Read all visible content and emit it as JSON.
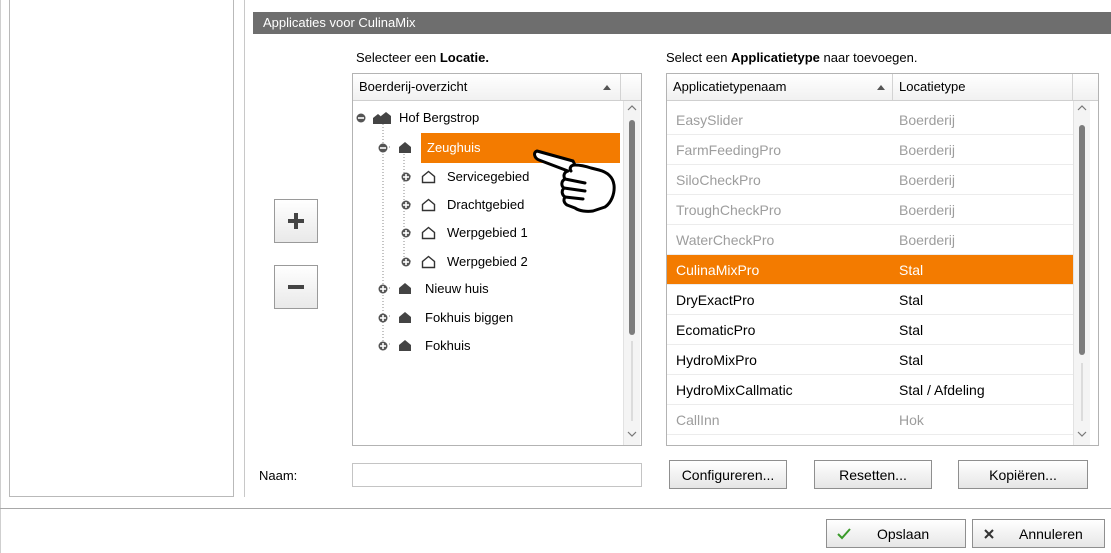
{
  "dialog": {
    "title": "Applicaties voor CulinaMix"
  },
  "locatie_panel": {
    "prompt_prefix": "Selecteer een ",
    "prompt_bold": "Locatie.",
    "column_header": "Boerderij-overzicht",
    "tree": [
      {
        "label": "Hof Bergstrop",
        "icon": "farm-icon",
        "expander": "collapse-icon"
      },
      {
        "label": "Zeughuis",
        "icon": "house-filled-icon",
        "expander": "collapse-icon",
        "selected": true
      },
      {
        "label": "Servicegebied",
        "icon": "house-outline-icon",
        "expander": "expand-icon"
      },
      {
        "label": "Drachtgebied",
        "icon": "house-outline-icon",
        "expander": "expand-icon"
      },
      {
        "label": "Werpgebied 1",
        "icon": "house-outline-icon",
        "expander": "expand-icon"
      },
      {
        "label": "Werpgebied 2",
        "icon": "house-outline-icon",
        "expander": "expand-icon"
      },
      {
        "label": "Nieuw huis",
        "icon": "house-filled-icon",
        "expander": "expand-icon"
      },
      {
        "label": "Fokhuis biggen",
        "icon": "house-filled-icon",
        "expander": "expand-icon"
      },
      {
        "label": "Fokhuis",
        "icon": "house-filled-icon",
        "expander": "expand-icon"
      }
    ]
  },
  "applicatie_panel": {
    "prompt_prefix": "Select een ",
    "prompt_bold": "Applicatietype",
    "prompt_suffix": " naar toevoegen.",
    "columns": [
      "Applicatietypenaam",
      "Locatietype"
    ],
    "rows": [
      {
        "name": "EasySlider",
        "type": "Boerderij",
        "enabled": false
      },
      {
        "name": "FarmFeedingPro",
        "type": "Boerderij",
        "enabled": false
      },
      {
        "name": "SiloCheckPro",
        "type": "Boerderij",
        "enabled": false
      },
      {
        "name": "TroughCheckPro",
        "type": "Boerderij",
        "enabled": false
      },
      {
        "name": "WaterCheckPro",
        "type": "Boerderij",
        "enabled": false
      },
      {
        "name": "CulinaMixPro",
        "type": "Stal",
        "enabled": true,
        "selected": true
      },
      {
        "name": "DryExactPro",
        "type": "Stal",
        "enabled": true
      },
      {
        "name": "EcomaticPro",
        "type": "Stal",
        "enabled": true
      },
      {
        "name": "HydroMixPro",
        "type": "Stal",
        "enabled": true
      },
      {
        "name": "HydroMixCallmatic",
        "type": "Stal / Afdeling",
        "enabled": true
      },
      {
        "name": "CallInn",
        "type": "Hok",
        "enabled": false
      }
    ]
  },
  "naam": {
    "label": "Naam:",
    "value": ""
  },
  "buttons": {
    "add": "+",
    "remove": "−",
    "configure": "Configureren...",
    "reset": "Resetten...",
    "copy": "Kopiëren...",
    "save": "Opslaan",
    "cancel": "Annuleren"
  },
  "colors": {
    "selection": "#f37b00",
    "title_bar": "#6e6e6e",
    "save_check": "#3a9a2a",
    "disabled_text": "#9d9d9d"
  }
}
